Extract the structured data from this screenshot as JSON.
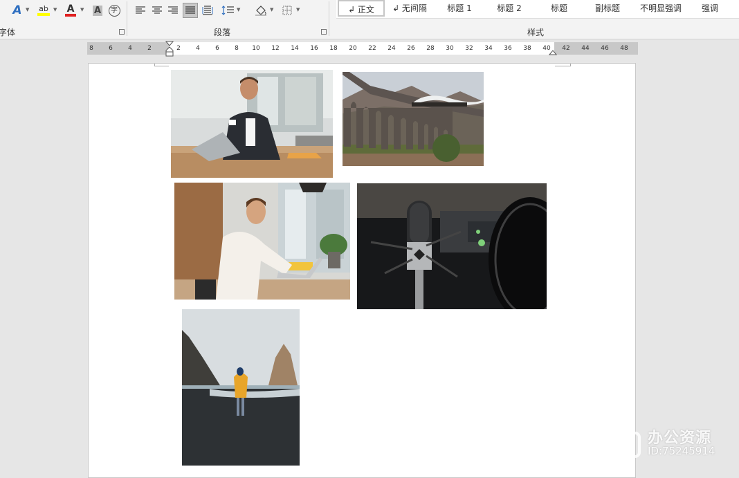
{
  "ribbon": {
    "font_group_label": "字体",
    "paragraph_group_label": "段落",
    "styles_group_label": "样式",
    "font_tools": [
      {
        "name": "text-effects-icon",
        "glyph": "A",
        "color": "#2f6fc0"
      },
      {
        "name": "highlight-icon",
        "glyph": "ab",
        "color": "#333333",
        "underline": "#ffff00"
      },
      {
        "name": "font-color-icon",
        "glyph": "A",
        "color": "#333333",
        "underline": "#e02020"
      },
      {
        "name": "char-shading-icon",
        "glyph": "A",
        "color": "#555555"
      },
      {
        "name": "enclose-char-icon",
        "glyph": "字",
        "color": "#444444"
      }
    ],
    "styles": [
      {
        "label": "正文",
        "prefix": "↲",
        "selected": true
      },
      {
        "label": "无间隔",
        "prefix": "↲",
        "selected": false
      },
      {
        "label": "标题 1",
        "prefix": "",
        "selected": false
      },
      {
        "label": "标题 2",
        "prefix": "",
        "selected": false
      },
      {
        "label": "标题",
        "prefix": "",
        "selected": false
      },
      {
        "label": "副标题",
        "prefix": "",
        "selected": false
      },
      {
        "label": "不明显强调",
        "prefix": "",
        "selected": false
      },
      {
        "label": "强调",
        "prefix": "",
        "selected": false
      }
    ]
  },
  "ruler": {
    "left_numbers": [
      "8",
      "6",
      "4",
      "2"
    ],
    "right_numbers": [
      "2",
      "4",
      "6",
      "8",
      "10",
      "12",
      "14",
      "16",
      "18",
      "20",
      "22",
      "24",
      "26",
      "28",
      "30",
      "32",
      "34",
      "36",
      "38",
      "40",
      "42",
      "44",
      "46",
      "48"
    ]
  },
  "photos": [
    {
      "name": "photo-businessman-coffee",
      "subject": "businessman with coffee at desk"
    },
    {
      "name": "photo-viaduct-train",
      "subject": "steam train on stone viaduct"
    },
    {
      "name": "photo-man-laptop",
      "subject": "man working on laptop"
    },
    {
      "name": "photo-microphone",
      "subject": "studio microphone"
    },
    {
      "name": "photo-beach-walker",
      "subject": "person in yellow coat on beach"
    }
  ],
  "watermark": {
    "line1": "办公资源",
    "line2": "ID:75245914"
  }
}
